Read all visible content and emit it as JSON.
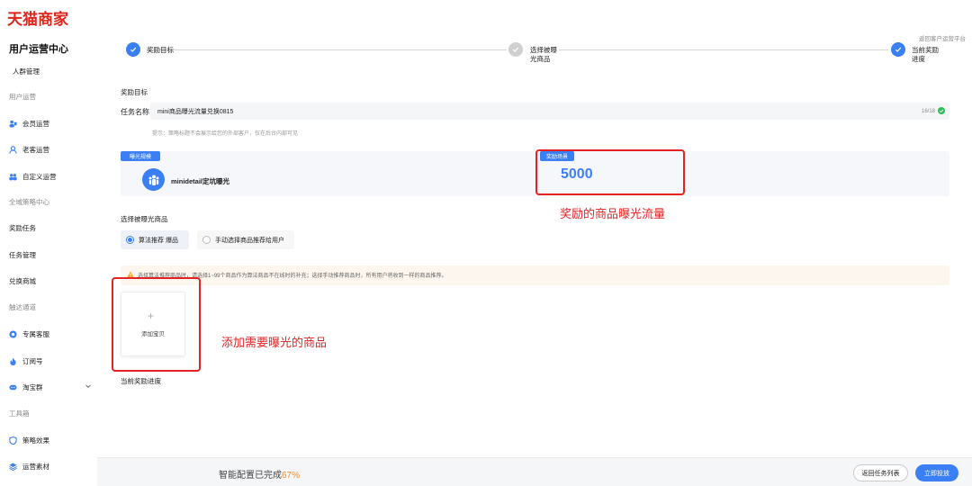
{
  "brand": {
    "logo_text": "天猫商家"
  },
  "sidebar": {
    "title": "用户运营中心",
    "items": [
      {
        "label": "人群管理",
        "icon": "",
        "grey": false
      },
      {
        "label": "用户运营",
        "icon": "",
        "grey": true
      },
      {
        "label": "会员运营",
        "icon": "member-icon",
        "grey": false
      },
      {
        "label": "老客运营",
        "icon": "user-icon",
        "grey": false
      },
      {
        "label": "自定义运营",
        "icon": "group-icon",
        "grey": false
      },
      {
        "label": "全域策略中心",
        "icon": "",
        "grey": true
      },
      {
        "label": "奖励任务",
        "icon": "",
        "grey": false
      },
      {
        "label": "任务管理",
        "icon": "",
        "grey": false
      },
      {
        "label": "兑换商城",
        "icon": "",
        "grey": false
      },
      {
        "label": "触达通道",
        "icon": "",
        "grey": true
      },
      {
        "label": "专属客服",
        "icon": "service-icon",
        "grey": false
      },
      {
        "label": "订阅号",
        "icon": "flame-icon",
        "grey": false
      },
      {
        "label": "淘宝群",
        "icon": "chat-group-icon",
        "grey": false
      },
      {
        "label": "工具箱",
        "icon": "",
        "grey": true
      },
      {
        "label": "策略效果",
        "icon": "shield-icon",
        "grey": false
      },
      {
        "label": "运营素材",
        "icon": "layers-icon",
        "grey": false
      }
    ]
  },
  "header": {
    "return_platform": "返回客户运营平台"
  },
  "steps": [
    {
      "label_lines": [
        "奖励目标"
      ],
      "state": "done"
    },
    {
      "label_lines": [
        "选择被曝",
        "光商品"
      ],
      "state": "pending"
    },
    {
      "label_lines": [
        "当前奖励",
        "进度"
      ],
      "state": "done"
    }
  ],
  "reward_goal": {
    "section_title": "奖励目标",
    "task_name_label": "任务名称",
    "task_name_value": "mini商品曝光流量兑换0815",
    "char_count": "16/18",
    "hint": "提示：策略标题不会展示给您的外部客户，仅在后台内部可见"
  },
  "exposure": {
    "tag": "曝光规模",
    "channel_name": "minidetail定坑曝光",
    "reward_tag": "奖励场景",
    "reward_value": "5000"
  },
  "annotations": {
    "reward_traffic": "奖励的商品曝光流量",
    "add_products": "添加需要曝光的商品"
  },
  "select_products": {
    "section_title": "选择被曝光商品",
    "option_algo": "算法推荐 爆品",
    "option_manual": "手动选择商品推荐给用户",
    "selected": "algo",
    "warning": "选择算法推荐商品时，请选择1~99个商品作为算法商品不在线时的补充；选择手动推荐商品时，所有用户将收到一样的商品推荐。",
    "add_label": "添加宝贝"
  },
  "progress_section": {
    "title": "当前奖励进度"
  },
  "footer": {
    "progress_prefix": "智能配置已完成",
    "progress_percent": "67%",
    "btn_return_list": "返回任务列表",
    "btn_launch": "立即投放"
  },
  "colors": {
    "primary": "#3b7ff5",
    "brand_red": "#e1251b",
    "annotation_red": "#e52222",
    "percent_orange": "#f08c2b"
  }
}
